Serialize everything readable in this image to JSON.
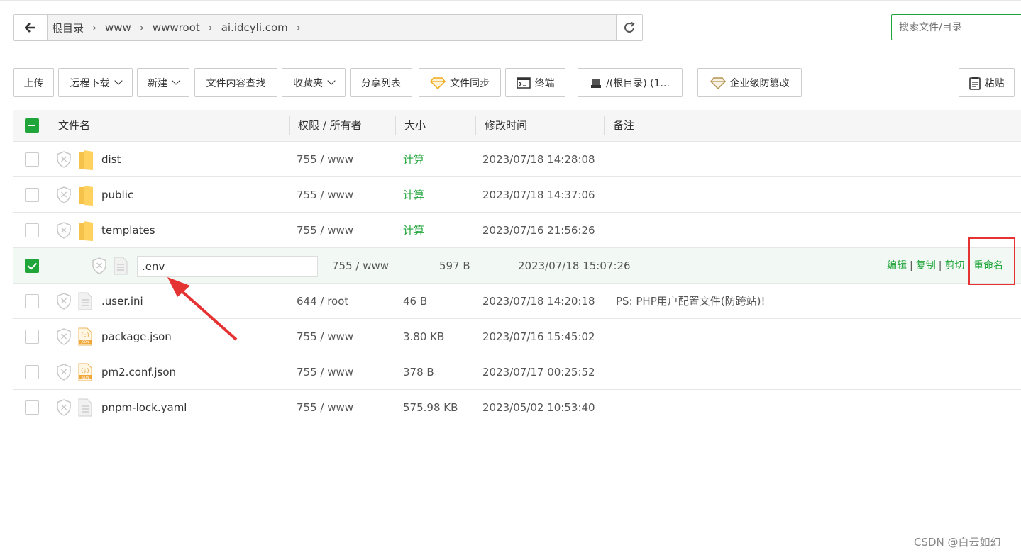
{
  "breadcrumb": [
    "根目录",
    "www",
    "wwwroot",
    "ai.idcyli.com"
  ],
  "search": {
    "placeholder": "搜索文件/目录"
  },
  "toolbar": {
    "upload": "上传",
    "remote_download": "远程下载",
    "new": "新建",
    "content_search": "文件内容查找",
    "favorites": "收藏夹",
    "share_list": "分享列表",
    "file_sync": "文件同步",
    "terminal": "终端",
    "disk": "/(根目录) (1...",
    "tamper_proof": "企业级防篡改",
    "paste": "粘贴"
  },
  "table": {
    "headers": {
      "name": "文件名",
      "perm": "权限 / 所有者",
      "size": "大小",
      "mtime": "修改时间",
      "note": "备注"
    },
    "rows": [
      {
        "name": "dist",
        "type": "folder",
        "perm": "755 / www",
        "size": "计算",
        "mtime": "2023/07/18 14:28:08",
        "note": ""
      },
      {
        "name": "public",
        "type": "folder",
        "perm": "755 / www",
        "size": "计算",
        "mtime": "2023/07/18 14:37:06",
        "note": ""
      },
      {
        "name": "templates",
        "type": "folder",
        "perm": "755 / www",
        "size": "计算",
        "mtime": "2023/07/16 21:56:26",
        "note": ""
      },
      {
        "name": ".env",
        "type": "file",
        "perm": "755 / www",
        "size": "597 B",
        "mtime": "2023/07/18 15:07:26",
        "note": "",
        "selected": true
      },
      {
        "name": ".user.ini",
        "type": "file",
        "perm": "644 / root",
        "size": "46 B",
        "mtime": "2023/07/18 14:20:18",
        "note": "PS: PHP用户配置文件(防跨站)!"
      },
      {
        "name": "package.json",
        "type": "json",
        "perm": "755 / www",
        "size": "3.80 KB",
        "mtime": "2023/07/16 15:45:02",
        "note": ""
      },
      {
        "name": "pm2.conf.json",
        "type": "json",
        "perm": "755 / www",
        "size": "378 B",
        "mtime": "2023/07/17 00:25:52",
        "note": ""
      },
      {
        "name": "pnpm-lock.yaml",
        "type": "file",
        "perm": "755 / www",
        "size": "575.98 KB",
        "mtime": "2023/05/02 10:53:40",
        "note": ""
      }
    ],
    "row_ops": [
      "编辑",
      "复制",
      "剪切",
      "重命名"
    ]
  },
  "watermark": "CSDN @白云如幻",
  "colors": {
    "accent": "#20a53a",
    "highlight": "#e53333"
  }
}
